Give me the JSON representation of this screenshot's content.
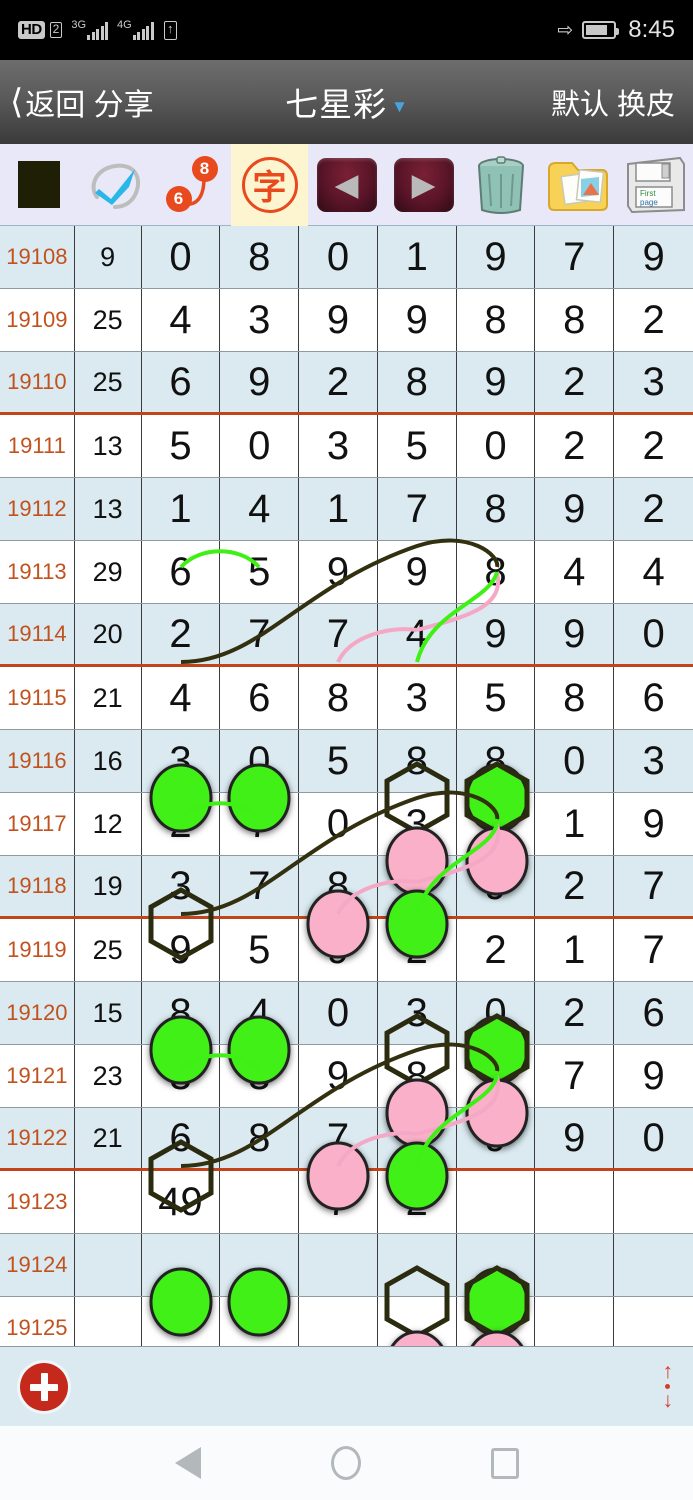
{
  "statusbar": {
    "hd_label": "HD",
    "sim_label": "2",
    "net1_label": "3G",
    "net2_label": "4G",
    "time": "8:45",
    "bluetooth_icon": "bluetooth-icon",
    "battery_icon": "battery-icon",
    "updown_icon": "data-transfer-icon"
  },
  "titlebar": {
    "back_label": "返回 分享",
    "back_icon": "chevron-left-icon",
    "title": "七星彩",
    "caret_icon": "chevron-down-icon",
    "right_label": "默认 换皮"
  },
  "toolbar": {
    "items": [
      {
        "name": "color-swatch-button",
        "label": "",
        "icon": "color-swatch-icon",
        "active": false
      },
      {
        "name": "check-lasso-button",
        "label": "",
        "icon": "check-lasso-icon",
        "active": false
      },
      {
        "name": "number-link-button",
        "label": "",
        "icon": "number-link-icon",
        "active": false,
        "num_start": "6",
        "num_end": "8"
      },
      {
        "name": "text-stamp-button",
        "label": "字",
        "icon": "character-stamp-icon",
        "active": true
      },
      {
        "name": "prev-button",
        "label": "",
        "icon": "arrow-left-icon",
        "active": false
      },
      {
        "name": "next-button",
        "label": "",
        "icon": "arrow-right-icon",
        "active": false
      },
      {
        "name": "trash-button",
        "label": "",
        "icon": "trash-icon",
        "active": false
      },
      {
        "name": "folder-photos-button",
        "label": "",
        "icon": "folder-photos-icon",
        "active": false
      },
      {
        "name": "save-button",
        "label": "",
        "icon": "floppy-disk-icon",
        "active": false
      }
    ],
    "stamp_glyph": "字",
    "arrow_left_glyph": "◀",
    "arrow_right_glyph": "▶",
    "disk_label_1": "First",
    "disk_label_2": "page"
  },
  "table": {
    "rows": [
      {
        "issue": "19108",
        "sum": "9",
        "digits": [
          "0",
          "8",
          "0",
          "1",
          "9",
          "7",
          "9"
        ],
        "alt": true,
        "sep": false
      },
      {
        "issue": "19109",
        "sum": "25",
        "digits": [
          "4",
          "3",
          "9",
          "9",
          "8",
          "8",
          "2"
        ],
        "alt": false,
        "sep": false
      },
      {
        "issue": "19110",
        "sum": "25",
        "digits": [
          "6",
          "9",
          "2",
          "8",
          "9",
          "2",
          "3"
        ],
        "alt": true,
        "sep": true
      },
      {
        "issue": "19111",
        "sum": "13",
        "digits": [
          "5",
          "0",
          "3",
          "5",
          "0",
          "2",
          "2"
        ],
        "alt": false,
        "sep": false
      },
      {
        "issue": "19112",
        "sum": "13",
        "digits": [
          "1",
          "4",
          "1",
          "7",
          "8",
          "9",
          "2"
        ],
        "alt": true,
        "sep": false
      },
      {
        "issue": "19113",
        "sum": "29",
        "digits": [
          "6",
          "5",
          "9",
          "9",
          "8",
          "4",
          "4"
        ],
        "alt": false,
        "sep": false
      },
      {
        "issue": "19114",
        "sum": "20",
        "digits": [
          "2",
          "7",
          "7",
          "4",
          "9",
          "9",
          "0"
        ],
        "alt": true,
        "sep": true
      },
      {
        "issue": "19115",
        "sum": "21",
        "digits": [
          "4",
          "6",
          "8",
          "3",
          "5",
          "8",
          "6"
        ],
        "alt": false,
        "sep": false
      },
      {
        "issue": "19116",
        "sum": "16",
        "digits": [
          "3",
          "0",
          "5",
          "8",
          "8",
          "0",
          "3"
        ],
        "alt": true,
        "sep": false
      },
      {
        "issue": "19117",
        "sum": "12",
        "digits": [
          "2",
          "7",
          "0",
          "3",
          "7",
          "1",
          "9"
        ],
        "alt": false,
        "sep": false
      },
      {
        "issue": "19118",
        "sum": "19",
        "digits": [
          "3",
          "7",
          "8",
          "1",
          "9",
          "2",
          "7"
        ],
        "alt": true,
        "sep": true
      },
      {
        "issue": "19119",
        "sum": "25",
        "digits": [
          "9",
          "5",
          "9",
          "2",
          "2",
          "1",
          "7"
        ],
        "alt": false,
        "sep": false
      },
      {
        "issue": "19120",
        "sum": "15",
        "digits": [
          "8",
          "4",
          "0",
          "3",
          "0",
          "2",
          "6"
        ],
        "alt": true,
        "sep": false
      },
      {
        "issue": "19121",
        "sum": "23",
        "digits": [
          "3",
          "3",
          "9",
          "8",
          "4",
          "7",
          "9"
        ],
        "alt": false,
        "sep": false
      },
      {
        "issue": "19122",
        "sum": "21",
        "digits": [
          "6",
          "8",
          "7",
          "0",
          "9",
          "9",
          "0"
        ],
        "alt": true,
        "sep": true
      },
      {
        "issue": "19123",
        "sum": "",
        "digits": [
          "49",
          "",
          "7",
          "2",
          "",
          "",
          ""
        ],
        "alt": false,
        "sep": false
      },
      {
        "issue": "19124",
        "sum": "",
        "digits": [
          "",
          "",
          "",
          "",
          "",
          "",
          ""
        ],
        "alt": true,
        "sep": false
      },
      {
        "issue": "19125",
        "sum": "",
        "digits": [
          "",
          "",
          "",
          "",
          "",
          "",
          ""
        ],
        "alt": false,
        "sep": false
      }
    ]
  },
  "annotations": {
    "colors": {
      "green": "#3ff014",
      "pink": "#f9b0c8",
      "hex_outline": "#2b2b10",
      "green_curve": "#3ff014",
      "pink_curve": "#f5a8c6",
      "dark_curve": "#33300f",
      "orange_sep": "#c1441a",
      "issue_text": "#c1521e",
      "row_alt_bg": "#daeaf0"
    },
    "groups": [
      {
        "row": 5,
        "green_circles": [
          0,
          1
        ],
        "hexagons": [
          3,
          4
        ],
        "green_in_hex": [
          4
        ]
      },
      {
        "row": 6,
        "pink_circles": [
          3,
          4
        ]
      },
      {
        "row": 7,
        "hexagons": [
          0
        ],
        "pink_circles": [
          2
        ],
        "green_circles": [
          3
        ]
      },
      {
        "row": 9,
        "green_circles": [
          0,
          1
        ],
        "hexagons": [
          3,
          4
        ],
        "green_in_hex": [
          4
        ]
      },
      {
        "row": 10,
        "pink_circles": [
          3,
          4
        ]
      },
      {
        "row": 11,
        "hexagons": [
          0
        ],
        "pink_circles": [
          2
        ],
        "green_circles": [
          3
        ]
      },
      {
        "row": 13,
        "green_circles": [
          0,
          1
        ],
        "hexagons": [
          3,
          4
        ],
        "green_in_hex": [
          4
        ]
      },
      {
        "row": 14,
        "pink_circles": [
          3,
          4
        ]
      },
      {
        "row": 15,
        "hexagons": [
          0
        ],
        "pink_circles": [
          2
        ],
        "green_circles": [
          3
        ]
      }
    ]
  },
  "bottombar": {
    "add_icon": "plus-circle-icon",
    "scroll_icon": "scroll-updown-icon",
    "up_glyph": "↑",
    "down_glyph": "↓"
  },
  "androidnav": {
    "back_icon": "nav-back-icon",
    "home_icon": "nav-home-icon",
    "recents_icon": "nav-recents-icon"
  }
}
